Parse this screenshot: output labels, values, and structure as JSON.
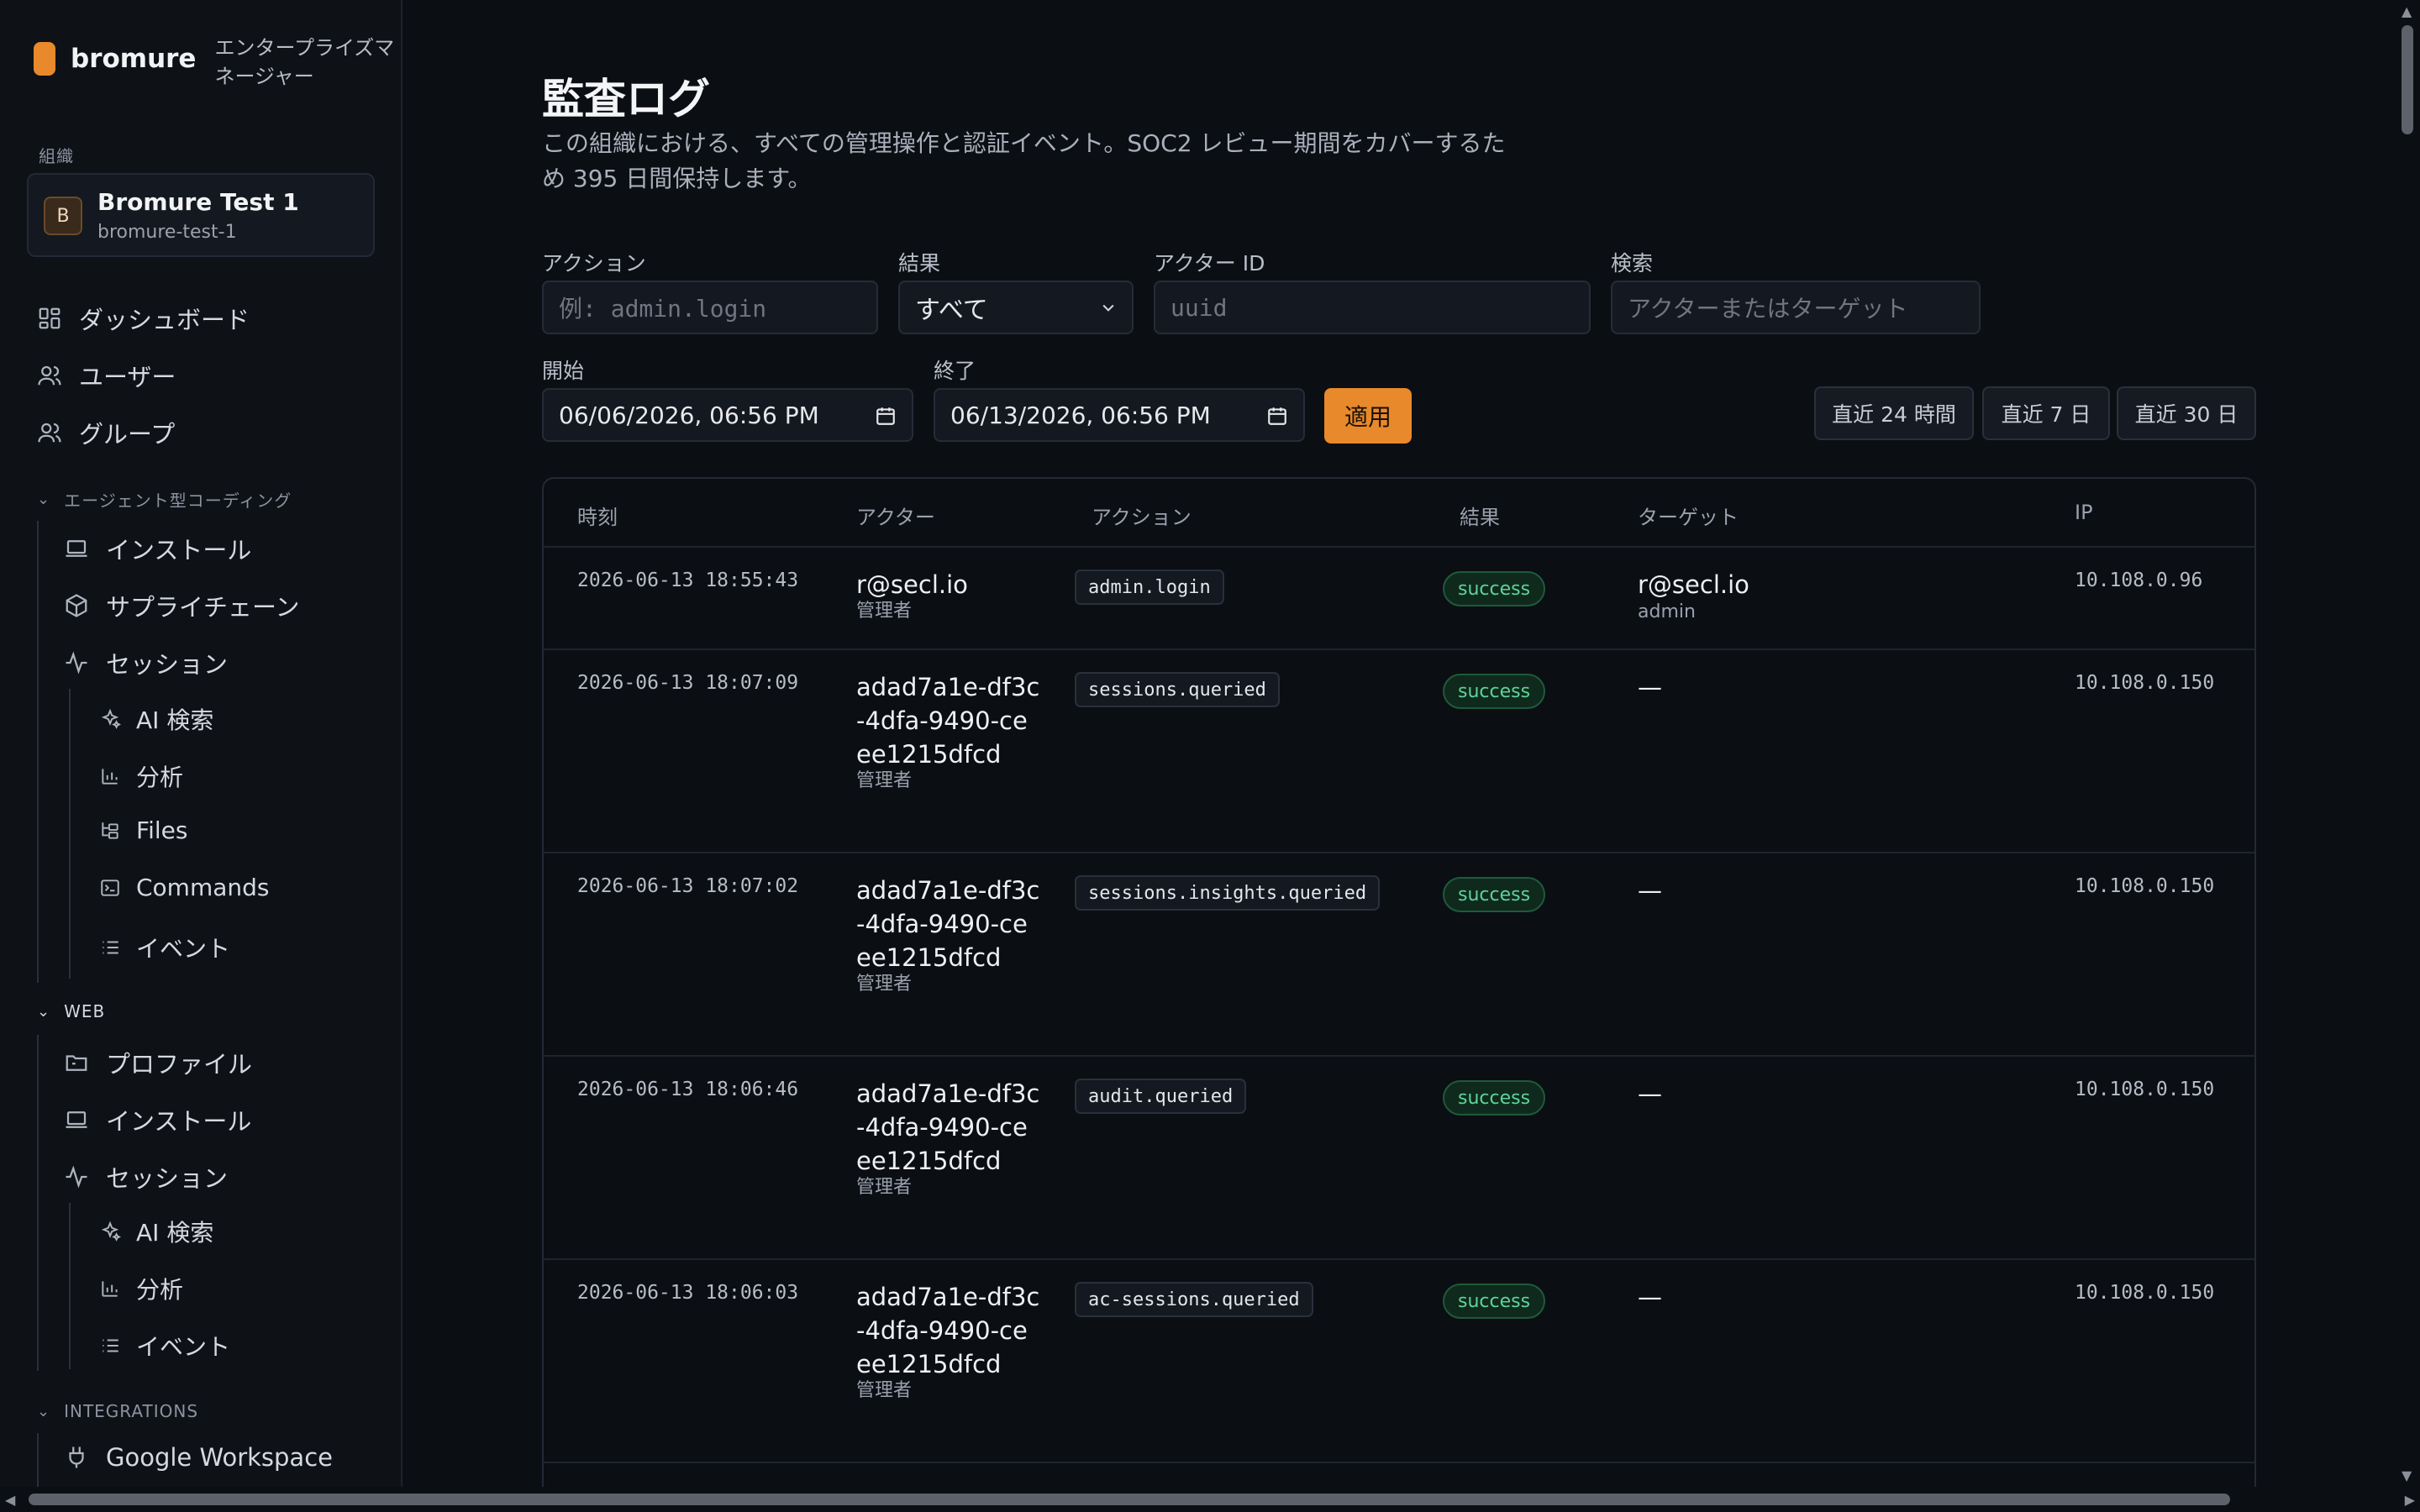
{
  "brand": {
    "name": "bromure",
    "subtitle": "エンタープライズマネージャー"
  },
  "org": {
    "section_label": "組織",
    "avatar": "B",
    "name": "Bromure Test 1",
    "slug": "bromure-test-1"
  },
  "nav": {
    "dashboard": "ダッシュボード",
    "users": "ユーザー",
    "groups": "グループ",
    "agent_section": "エージェント型コーディング",
    "agent_install": "インストール",
    "agent_supply": "サプライチェーン",
    "agent_sessions": "セッション",
    "agent_ai_search": "AI 検索",
    "agent_analytics": "分析",
    "agent_files": "Files",
    "agent_commands": "Commands",
    "agent_events": "イベント",
    "web_section": "WEB",
    "web_profile": "プロファイル",
    "web_install": "インストール",
    "web_sessions": "セッション",
    "web_ai_search": "AI 検索",
    "web_analytics": "分析",
    "web_events": "イベント",
    "integrations_section": "INTEGRATIONS",
    "google_workspace": "Google Workspace"
  },
  "page": {
    "title": "監査ログ",
    "description": "この組織における、すべての管理操作と認証イベント。SOC2 レビュー期間をカバーするため 395 日間保持します。"
  },
  "filters": {
    "action_label": "アクション",
    "action_placeholder": "例: admin.login",
    "result_label": "結果",
    "result_value": "すべて",
    "actor_label": "アクター ID",
    "actor_placeholder": "uuid",
    "search_label": "検索",
    "search_placeholder": "アクターまたはターゲット",
    "start_label": "開始",
    "start_value": "06/06/2026, 06:56 PM",
    "end_label": "終了",
    "end_value": "06/13/2026, 06:56 PM",
    "apply": "適用",
    "range_24h": "直近 24 時間",
    "range_7d": "直近 7 日",
    "range_30d": "直近 30 日"
  },
  "table": {
    "headers": {
      "time": "時刻",
      "actor": "アクター",
      "action": "アクション",
      "result": "結果",
      "target": "ターゲット",
      "ip": "IP"
    },
    "rows": [
      {
        "time": "2026-06-13 18:55:43",
        "actor": "r@secl.io",
        "role": "管理者",
        "action": "admin.login",
        "result": "success",
        "target": "r@secl.io",
        "target_sub": "admin",
        "ip": "10.108.0.96"
      },
      {
        "time": "2026-06-13 18:07:09",
        "actor": "adad7a1e-df3c-4dfa-9490-ceee1215dfcd",
        "role": "管理者",
        "action": "sessions.queried",
        "result": "success",
        "target": "—",
        "target_sub": "",
        "ip": "10.108.0.150"
      },
      {
        "time": "2026-06-13 18:07:02",
        "actor": "adad7a1e-df3c-4dfa-9490-ceee1215dfcd",
        "role": "管理者",
        "action": "sessions.insights.queried",
        "result": "success",
        "target": "—",
        "target_sub": "",
        "ip": "10.108.0.150"
      },
      {
        "time": "2026-06-13 18:06:46",
        "actor": "adad7a1e-df3c-4dfa-9490-ceee1215dfcd",
        "role": "管理者",
        "action": "audit.queried",
        "result": "success",
        "target": "—",
        "target_sub": "",
        "ip": "10.108.0.150"
      },
      {
        "time": "2026-06-13 18:06:03",
        "actor": "adad7a1e-df3c-4dfa-9490-ceee1215dfcd",
        "role": "管理者",
        "action": "ac-sessions.queried",
        "result": "success",
        "target": "—",
        "target_sub": "",
        "ip": "10.108.0.150"
      }
    ]
  }
}
